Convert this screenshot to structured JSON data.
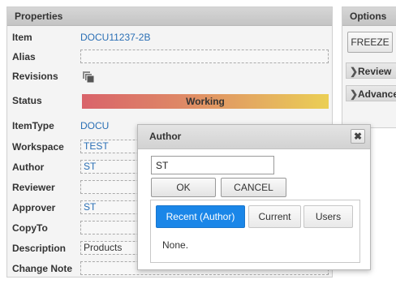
{
  "properties": {
    "title": "Properties",
    "fields": {
      "item": {
        "label": "Item",
        "value": "DOCU11237-2B"
      },
      "alias": {
        "label": "Alias",
        "value": ""
      },
      "revisions": {
        "label": "Revisions"
      },
      "status": {
        "label": "Status",
        "value": "Working"
      },
      "itemtype": {
        "label": "ItemType",
        "value": "DOCU"
      },
      "workspace": {
        "label": "Workspace",
        "value": "TEST"
      },
      "author": {
        "label": "Author",
        "value": "ST"
      },
      "reviewer": {
        "label": "Reviewer",
        "value": ""
      },
      "approver": {
        "label": "Approver",
        "value": "ST"
      },
      "copyto": {
        "label": "CopyTo",
        "value": ""
      },
      "description": {
        "label": "Description",
        "value": "Products"
      },
      "changenote": {
        "label": "Change Note",
        "value": ""
      }
    }
  },
  "options": {
    "title": "Options",
    "freeze_label": "FREEZE",
    "items": [
      {
        "label": "Review",
        "icon": "chevron-right-icon"
      },
      {
        "label": "Advance",
        "icon": "chevron-right-icon"
      }
    ]
  },
  "dialog": {
    "title": "Author",
    "input_value": "ST",
    "ok_label": "OK",
    "cancel_label": "CANCEL",
    "tabs": [
      {
        "label": "Recent (Author)",
        "active": true
      },
      {
        "label": "Current",
        "active": false
      },
      {
        "label": "Users",
        "active": false
      }
    ],
    "empty_text": "None."
  },
  "colors": {
    "link": "#2a6fb5",
    "active_tab": "#1a86e8",
    "status_gradient": [
      "#d9636a",
      "#ebcf54"
    ]
  }
}
